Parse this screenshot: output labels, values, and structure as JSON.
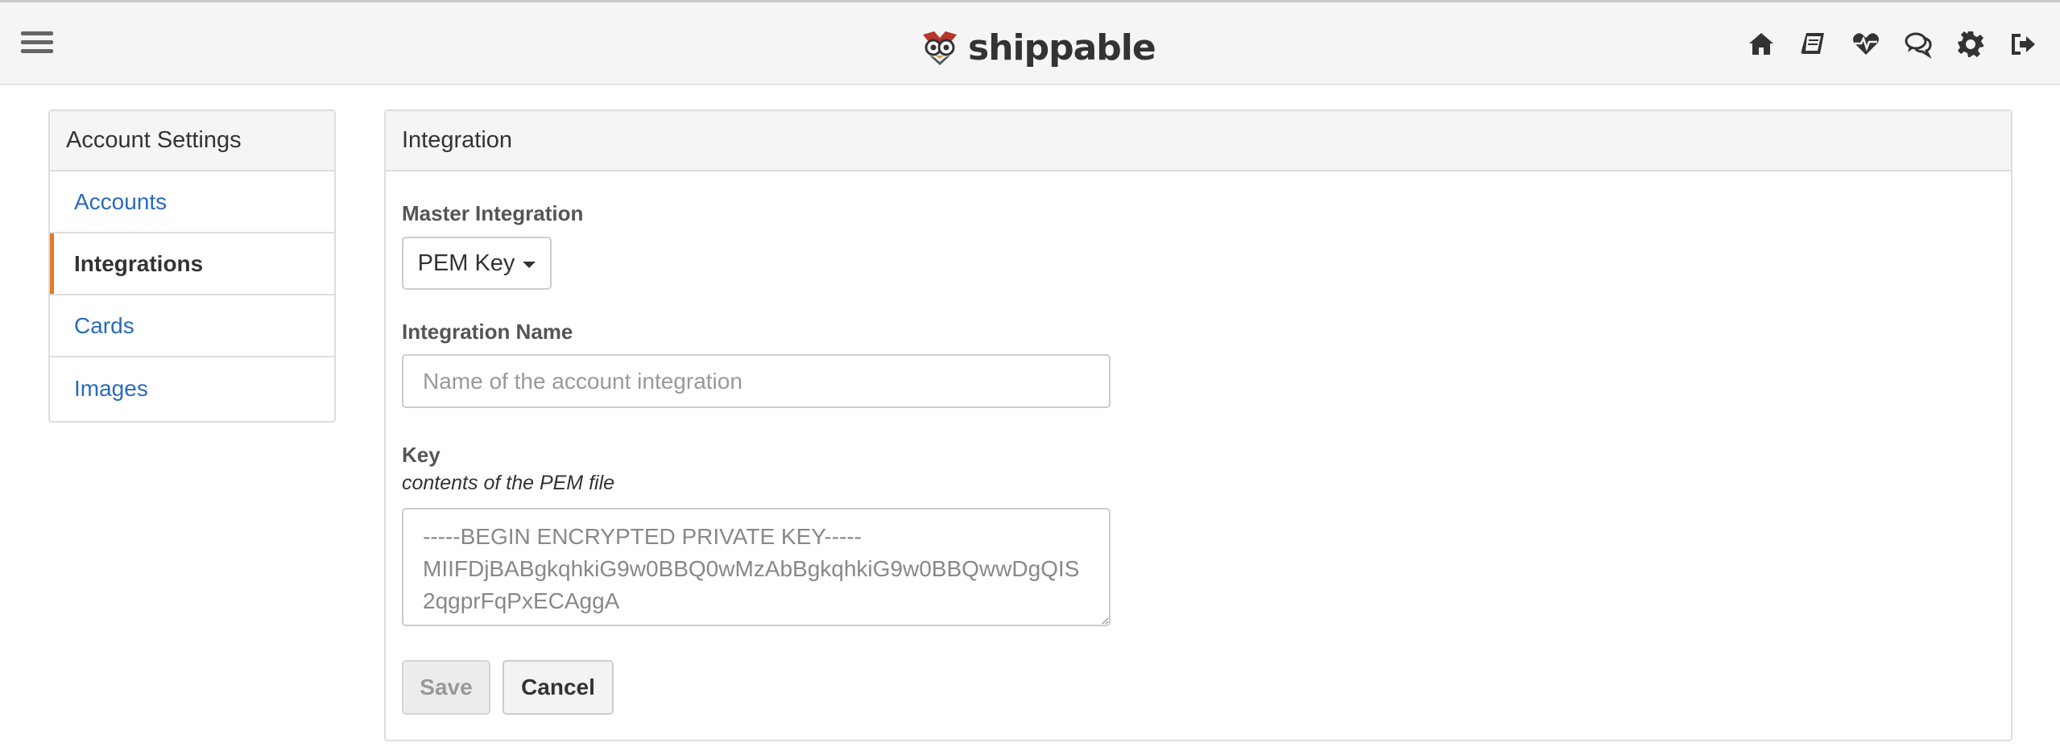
{
  "navbar": {
    "brand_name": "shippable",
    "icons": [
      "home-icon",
      "book-icon",
      "heartbeat-icon",
      "comments-icon",
      "gear-icon",
      "sign-out-icon"
    ]
  },
  "sidebar": {
    "heading": "Account Settings",
    "items": [
      {
        "label": "Accounts",
        "active": false
      },
      {
        "label": "Integrations",
        "active": true
      },
      {
        "label": "Cards",
        "active": false
      },
      {
        "label": "Images",
        "active": false
      }
    ]
  },
  "main": {
    "heading": "Integration",
    "master_integration": {
      "label": "Master Integration",
      "selected": "PEM Key"
    },
    "integration_name": {
      "label": "Integration Name",
      "value": "",
      "placeholder": "Name of the account integration"
    },
    "key": {
      "label": "Key",
      "hint": "contents of the PEM file",
      "value": "",
      "placeholder": "-----BEGIN ENCRYPTED PRIVATE KEY-----\nMIIFDjBABgkqhkiG9w0BBQ0wMzAbBgkqhkiG9w0BBQwwDgQIS2qgprFqPxECAggA"
    },
    "buttons": {
      "save_label": "Save",
      "cancel_label": "Cancel"
    }
  },
  "colors": {
    "link": "#2a6bb8",
    "active_indicator": "#e07a28",
    "panel_heading_bg": "#f5f5f5"
  }
}
